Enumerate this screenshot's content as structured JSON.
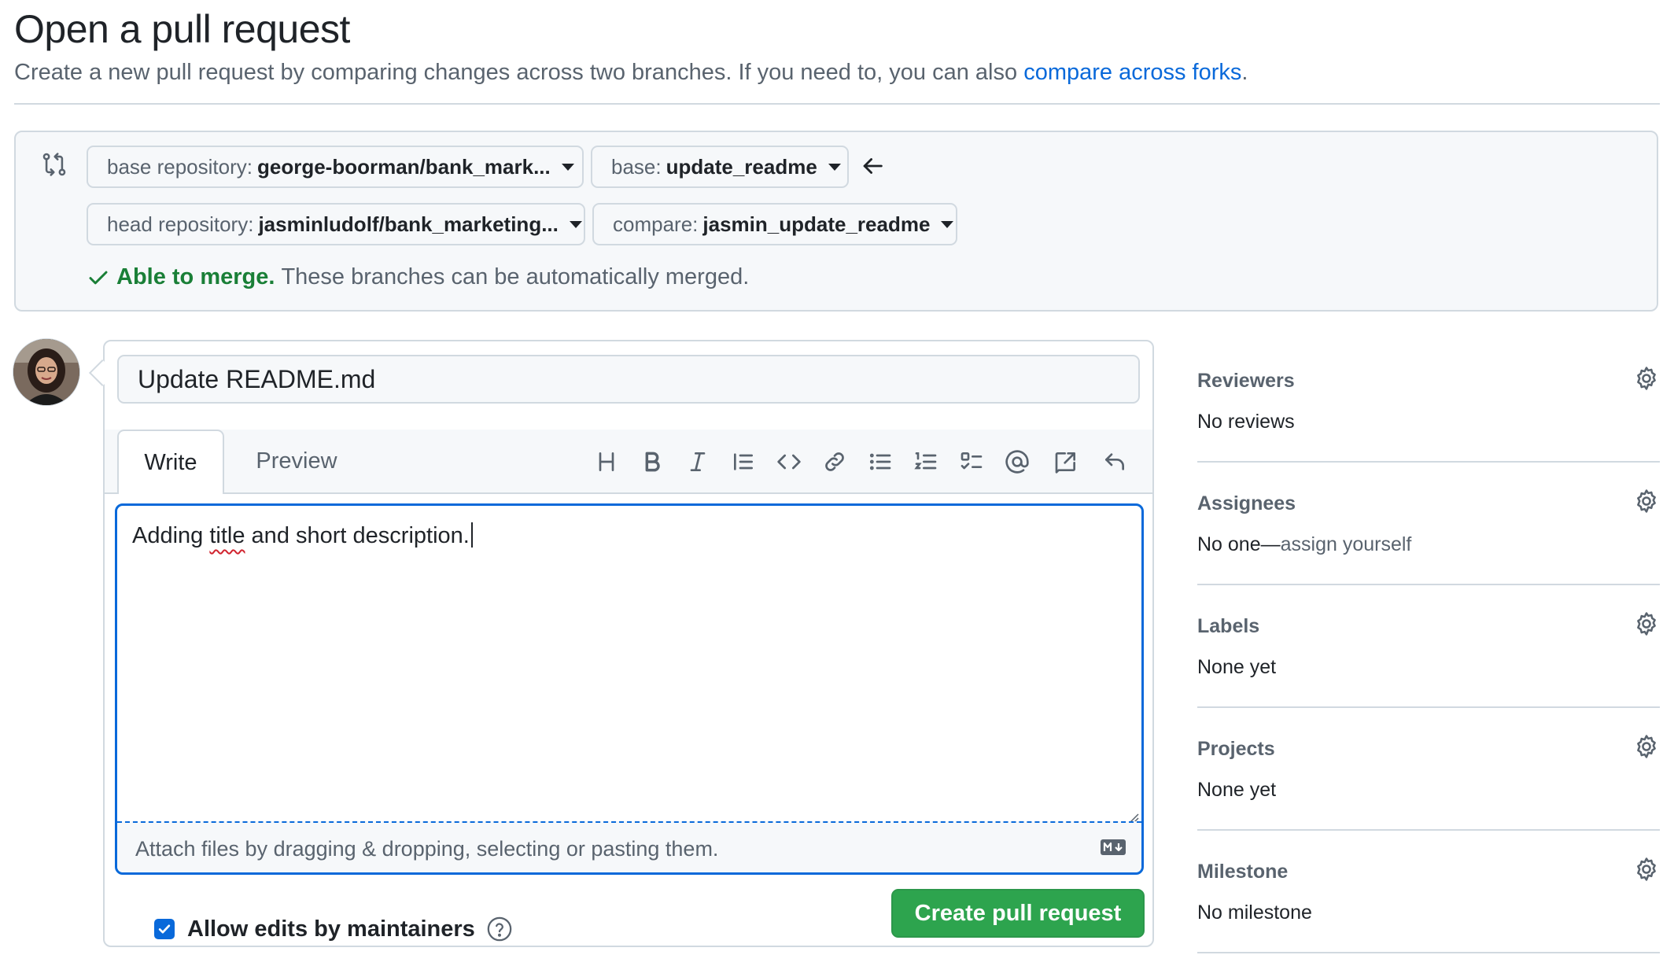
{
  "header": {
    "title": "Open a pull request",
    "subtitle_prefix": "Create a new pull request by comparing changes across two branches. If you need to, you can also ",
    "subtitle_link": "compare across forks",
    "subtitle_suffix": "."
  },
  "compare": {
    "base_repo_label": "base repository:",
    "base_repo_value": "george-boorman/bank_mark...",
    "base_label": "base:",
    "base_value": "update_readme",
    "head_repo_label": "head repository:",
    "head_repo_value": "jasminludolf/bank_marketing...",
    "compare_label": "compare:",
    "compare_value": "jasmin_update_readme",
    "merge_ok": "Able to merge.",
    "merge_msg": "These branches can be automatically merged."
  },
  "editor": {
    "title_value": "Update README.md",
    "tabs": {
      "write": "Write",
      "preview": "Preview"
    },
    "toolbar_icons": [
      "heading-icon",
      "bold-icon",
      "italic-icon",
      "quote-icon",
      "code-icon",
      "link-icon",
      "unordered-list-icon",
      "ordered-list-icon",
      "task-list-icon",
      "mention-icon",
      "reference-icon",
      "undo-icon"
    ],
    "body_before": "Adding ",
    "body_misspelled": "title",
    "body_after": " and short description.",
    "attach_text": "Attach files by dragging & dropping, selecting or pasting them.",
    "allow_edits": "Allow edits by maintainers",
    "create_button": "Create pull request"
  },
  "sidebar": {
    "reviewers": {
      "heading": "Reviewers",
      "value": "No reviews"
    },
    "assignees": {
      "heading": "Assignees",
      "value": "No one—",
      "link": "assign yourself"
    },
    "labels": {
      "heading": "Labels",
      "value": "None yet"
    },
    "projects": {
      "heading": "Projects",
      "value": "None yet"
    },
    "milestone": {
      "heading": "Milestone",
      "value": "No milestone"
    }
  },
  "colors": {
    "accent_blue": "#0969da",
    "success_green": "#1a7f37",
    "button_green": "#2da44e",
    "border": "#d1d9e0",
    "muted_text": "#59636e"
  }
}
